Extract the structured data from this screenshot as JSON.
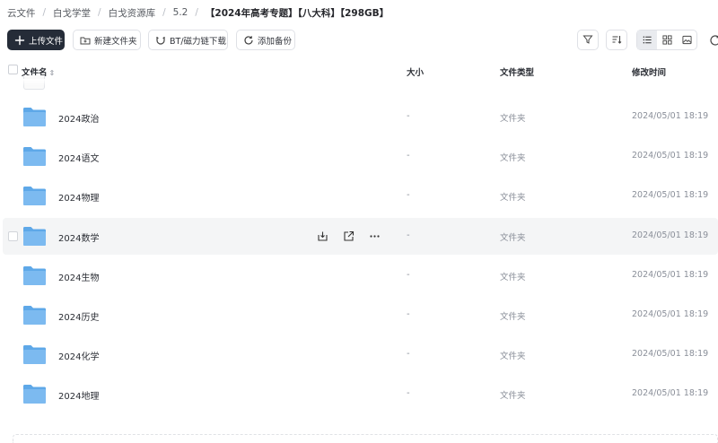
{
  "breadcrumb": {
    "items": [
      "云文件",
      "白戈学堂",
      "白戈资源库",
      "5.2",
      "【2024年高考专题】【八大科】【298GB】"
    ]
  },
  "toolbar": {
    "upload_label": "上传文件",
    "new_folder_label": "新建文件夹",
    "bt_download_label": "BT/磁力链下载",
    "add_backup_label": "添加备份"
  },
  "table": {
    "headers": {
      "name": "文件名",
      "size": "大小",
      "type": "文件类型",
      "modified": "修改时间"
    },
    "rows": [
      {
        "name": "2024政治",
        "size": "-",
        "type": "文件夹",
        "modified": "2024/05/01 18:19"
      },
      {
        "name": "2024语文",
        "size": "-",
        "type": "文件夹",
        "modified": "2024/05/01 18:19"
      },
      {
        "name": "2024物理",
        "size": "-",
        "type": "文件夹",
        "modified": "2024/05/01 18:19"
      },
      {
        "name": "2024数学",
        "size": "-",
        "type": "文件夹",
        "modified": "2024/05/01 18:19"
      },
      {
        "name": "2024生物",
        "size": "-",
        "type": "文件夹",
        "modified": "2024/05/01 18:19"
      },
      {
        "name": "2024历史",
        "size": "-",
        "type": "文件夹",
        "modified": "2024/05/01 18:19"
      },
      {
        "name": "2024化学",
        "size": "-",
        "type": "文件夹",
        "modified": "2024/05/01 18:19"
      },
      {
        "name": "2024地理",
        "size": "-",
        "type": "文件夹",
        "modified": "2024/05/01 18:19"
      }
    ]
  },
  "colors": {
    "primary_button": "#252c38",
    "folder": "#5ea8e8",
    "row_hover": "#f4f5f6"
  }
}
